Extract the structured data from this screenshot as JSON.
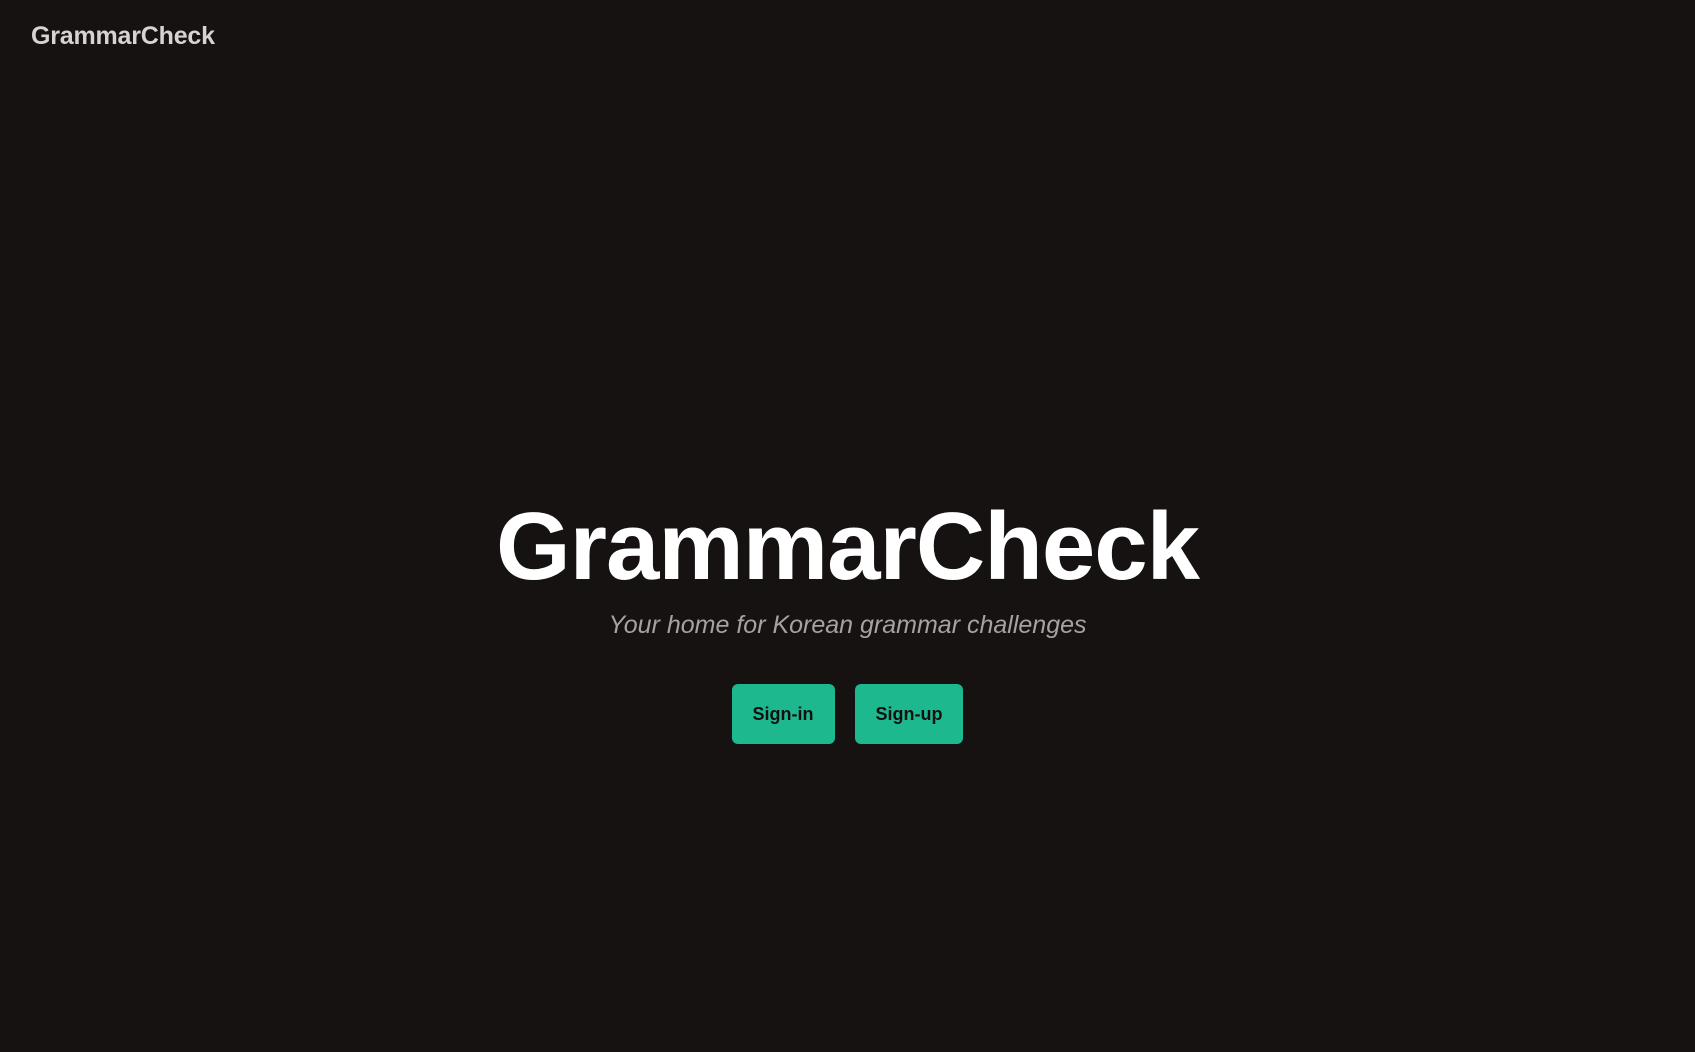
{
  "header": {
    "brand": "GrammarCheck"
  },
  "hero": {
    "title": "GrammarCheck",
    "subtitle": "Your home for Korean grammar challenges"
  },
  "actions": {
    "signin_label": "Sign-in",
    "signup_label": "Sign-up"
  },
  "colors": {
    "background": "#161211",
    "accent": "#1db88e",
    "title": "#ffffff",
    "subtitle": "#a8a29e",
    "brand": "#d6d3d1"
  }
}
